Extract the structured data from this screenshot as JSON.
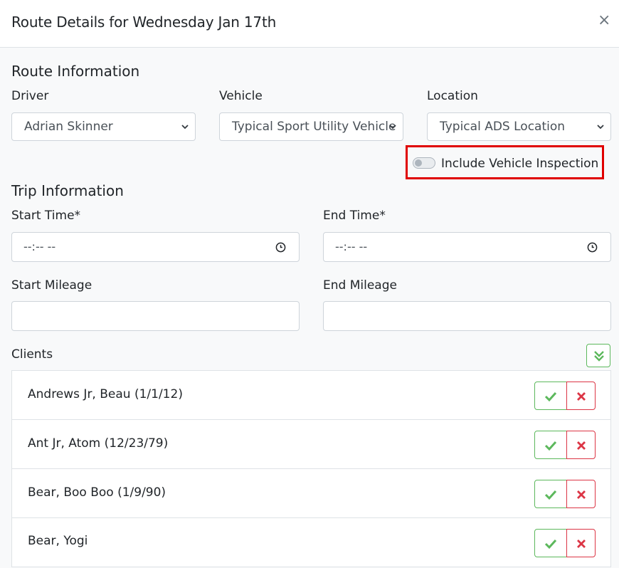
{
  "modal": {
    "title": "Route Details for Wednesday Jan 17th",
    "close_glyph": "×"
  },
  "route_info": {
    "heading": "Route Information",
    "driver": {
      "label": "Driver",
      "value": "Adrian Skinner"
    },
    "vehicle": {
      "label": "Vehicle",
      "value": "Typical Sport Utility Vehicle"
    },
    "location": {
      "label": "Location",
      "value": "Typical ADS Location"
    },
    "inspection_toggle": {
      "label": "Include Vehicle Inspection",
      "checked": false
    }
  },
  "trip_info": {
    "heading": "Trip Information",
    "start_time": {
      "label": "Start Time*",
      "placeholder": "--:-- --"
    },
    "end_time": {
      "label": "End Time*",
      "placeholder": "--:-- --"
    },
    "start_mileage": {
      "label": "Start Mileage",
      "value": ""
    },
    "end_mileage": {
      "label": "End Mileage",
      "value": ""
    }
  },
  "clients": {
    "label": "Clients",
    "items": [
      {
        "name": "Andrews Jr, Beau (1/1/12)"
      },
      {
        "name": "Ant Jr, Atom (12/23/79)"
      },
      {
        "name": "Bear, Boo Boo (1/9/90)"
      },
      {
        "name": "Bear, Yogi"
      }
    ]
  },
  "icons": {
    "close": "close-icon",
    "chevron": "chevron-down-icon",
    "clock": "clock-icon",
    "check_all": "double-check-icon",
    "confirm": "check-icon",
    "reject": "x-icon"
  },
  "colors": {
    "success": "#5cb85c",
    "danger": "#dc3545",
    "highlight": "#e00000"
  }
}
